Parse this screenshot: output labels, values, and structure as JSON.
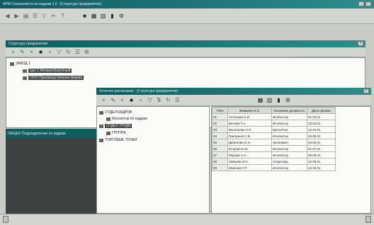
{
  "main_window": {
    "title": "АРМ Специалиста по кадрам 1.0 - [Структура предприятия]",
    "controls": [
      "_",
      "□",
      "×"
    ]
  },
  "main_toolbar": {
    "icons": [
      "back-icon",
      "forward-icon",
      "tree-icon",
      "list-icon",
      "filter-icon",
      "cut-icon",
      "help-icon",
      "print-icon",
      "calendar-icon",
      "grid-icon",
      "chart-icon",
      "settings-icon"
    ]
  },
  "structure_window": {
    "title": "Структура предприятия",
    "tree": {
      "root": "ЗАВОД 1",
      "child_1": "Цех 1 Механосборочный",
      "child_2": "ООО Производственная фирма"
    },
    "left_caption": "ОБЩЕЕ Подразделение по кадрам"
  },
  "staff_window": {
    "title": "Штатное расписание - [Структура предприятия]",
    "tree": {
      "dept": "ОТДЕЛ КАДРОВ",
      "sub_1": "Инспектор по кадрам",
      "selected": "ОТДЕЛ ТРУДА",
      "sub_2": "ГРУППА",
      "sub_3": "ТОРГОВЫЕ ТОЧКИ"
    },
    "table": {
      "headers": [
        "Табн",
        "Фамилия И.О.",
        "Основная должность",
        "Дата приема"
      ],
      "rows": [
        [
          "01",
          "Антонова Н.И.",
          "Инспектор",
          "01.02.01"
        ],
        [
          "02",
          "Белова Т.А.",
          "Инспектор",
          "03.03.01"
        ],
        [
          "03",
          "Васильева Л.П.",
          "Бухгалтер",
          "12.04.01"
        ],
        [
          "04",
          "Григорьев С.В.",
          "Инспектор",
          "15.05.01"
        ],
        [
          "05",
          "Данилова О.Н.",
          "Экономист",
          "20.06.01"
        ],
        [
          "06",
          "Егорова Е.М.",
          "Инспектор",
          "01.07.01"
        ],
        [
          "07",
          "Жукова А.А.",
          "Инспектор",
          "05.08.01"
        ],
        [
          "08",
          "Зайцева И.Н.",
          "Секретарь",
          "10.09.01"
        ],
        [
          "09",
          "Иванова Г.П.",
          "Инспектор",
          "14.10.01"
        ]
      ]
    }
  }
}
